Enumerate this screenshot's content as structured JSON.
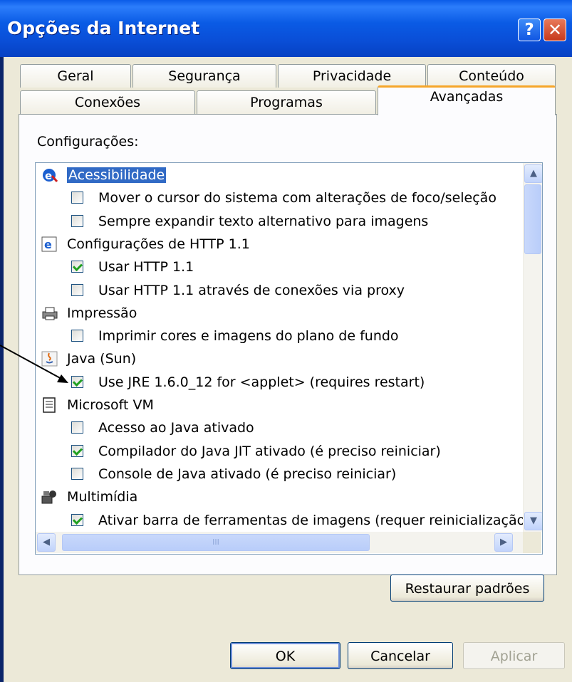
{
  "window": {
    "title": "Opções da Internet",
    "help_label": "?",
    "close_label": "✕"
  },
  "tabs": {
    "row1": [
      "Geral",
      "Segurança",
      "Privacidade",
      "Conteúdo"
    ],
    "row2": [
      "Conexões",
      "Programas",
      "Avançadas"
    ],
    "active": "Avançadas"
  },
  "settings_label": "Configurações:",
  "settings_list": [
    {
      "type": "category",
      "icon": "accessibility-icon",
      "label": "Acessibilidade",
      "selected": true
    },
    {
      "type": "option",
      "label": "Mover o cursor do sistema com alterações de foco/seleção",
      "checked": false
    },
    {
      "type": "option",
      "label": "Sempre expandir texto alternativo para imagens",
      "checked": false
    },
    {
      "type": "category",
      "icon": "ie-icon",
      "label": "Configurações de HTTP 1.1",
      "selected": false
    },
    {
      "type": "option",
      "label": "Usar HTTP 1.1",
      "checked": true
    },
    {
      "type": "option",
      "label": "Usar HTTP 1.1 através de conexões via proxy",
      "checked": false
    },
    {
      "type": "category",
      "icon": "printer-icon",
      "label": "Impressão",
      "selected": false
    },
    {
      "type": "option",
      "label": "Imprimir cores e imagens do plano de fundo",
      "checked": false
    },
    {
      "type": "category",
      "icon": "java-icon",
      "label": "Java (Sun)",
      "selected": false
    },
    {
      "type": "option",
      "label": "Use JRE 1.6.0_12 for <applet> (requires restart)",
      "checked": true
    },
    {
      "type": "category",
      "icon": "document-icon",
      "label": "Microsoft VM",
      "selected": false
    },
    {
      "type": "option",
      "label": "Acesso ao Java ativado",
      "checked": false
    },
    {
      "type": "option",
      "label": "Compilador do Java JIT ativado (é preciso reiniciar)",
      "checked": true
    },
    {
      "type": "option",
      "label": "Console de Java ativado (é preciso reiniciar)",
      "checked": false
    },
    {
      "type": "category",
      "icon": "multimedia-icon",
      "label": "Multimídia",
      "selected": false
    },
    {
      "type": "option",
      "label": "Ativar barra de ferramentas de imagens (requer reinicialização)",
      "checked": true
    }
  ],
  "scrollbar": {
    "up": "▲",
    "down": "▼",
    "left": "◀",
    "right": "▶",
    "grip": "III"
  },
  "buttons": {
    "restore": "Restaurar padrões",
    "ok": "OK",
    "cancel": "Cancelar",
    "apply": "Aplicar"
  }
}
